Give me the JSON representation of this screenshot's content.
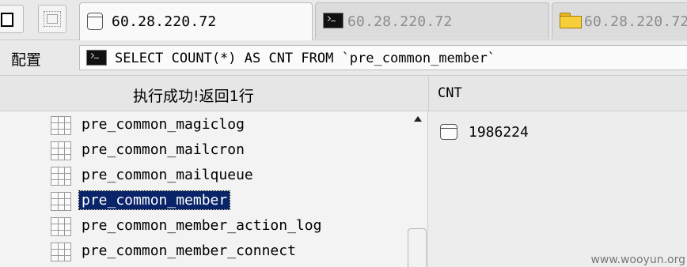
{
  "tabs": [
    {
      "label": "60.28.220.72",
      "icon": "database-icon",
      "active": true
    },
    {
      "label": "60.28.220.72",
      "icon": "terminal-icon",
      "active": false
    },
    {
      "label": "60.28.220.72",
      "icon": "folder-icon",
      "active": false
    }
  ],
  "querybar": {
    "config_label": "配置",
    "query": "SELECT COUNT(*) AS CNT FROM `pre_common_member`"
  },
  "result_header": {
    "status": "执行成功!返回1行",
    "column": "CNT"
  },
  "tables": [
    "pre_common_magiclog",
    "pre_common_mailcron",
    "pre_common_mailqueue",
    "pre_common_member",
    "pre_common_member_action_log",
    "pre_common_member_connect"
  ],
  "selected_table": "pre_common_member",
  "result": {
    "value": "1986224"
  },
  "watermark": "www.wooyun.org",
  "colors": {
    "selection": "#0a246a",
    "folder": "#f6cf3a"
  }
}
